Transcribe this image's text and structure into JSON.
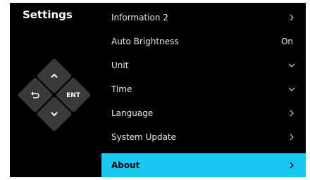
{
  "screen": {
    "title": "Settings"
  },
  "dpad": {
    "up_icon": "chevron-up-icon",
    "down_icon": "chevron-down-icon",
    "back_icon": "back-arrow-icon",
    "enter_label": "ENT"
  },
  "menu": {
    "items": [
      {
        "label": "Information 2",
        "value": "",
        "indicator": "chevron-right-icon",
        "selected": false
      },
      {
        "label": "Auto Brightness",
        "value": "On",
        "indicator": "",
        "selected": false
      },
      {
        "label": "Unit",
        "value": "",
        "indicator": "chevron-down-icon",
        "selected": false
      },
      {
        "label": "Time",
        "value": "",
        "indicator": "chevron-down-icon",
        "selected": false
      },
      {
        "label": "Language",
        "value": "",
        "indicator": "chevron-right-icon",
        "selected": false
      },
      {
        "label": "System Update",
        "value": "",
        "indicator": "chevron-right-icon",
        "selected": false
      },
      {
        "label": "About",
        "value": "",
        "indicator": "chevron-right-icon",
        "selected": true
      }
    ]
  },
  "colors": {
    "background": "#000000",
    "selected": "#18c8f2",
    "key": "#3a3a3a",
    "text": "#e6e6e6"
  }
}
